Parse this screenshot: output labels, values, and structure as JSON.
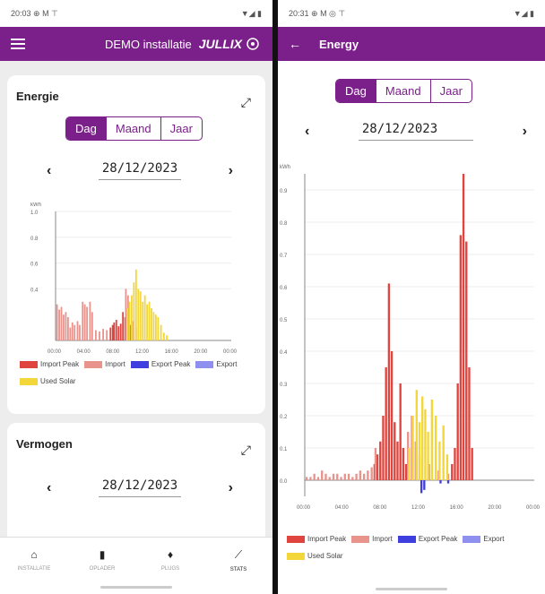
{
  "left": {
    "status": {
      "time": "20:03 ⊕ M ⊤",
      "icons": "▼◢ ▮"
    },
    "appbar": {
      "title": "DEMO installatie",
      "brand": "JULLIX"
    },
    "energy_card": {
      "title": "Energie",
      "tabs": [
        "Dag",
        "Maand",
        "Jaar"
      ],
      "date": "28/12/2023",
      "prev": "‹",
      "next": "›",
      "unit": "kWh"
    },
    "power_card": {
      "title": "Vermogen",
      "date": "28/12/2023",
      "prev": "‹",
      "next": "›"
    },
    "nav": [
      {
        "label": "INSTALLATIE",
        "icon": "home-bolt-icon"
      },
      {
        "label": "OPLADER",
        "icon": "charger-icon"
      },
      {
        "label": "PLUGS",
        "icon": "plug-icon"
      },
      {
        "label": "STATS",
        "icon": "chart-icon"
      }
    ]
  },
  "right": {
    "status": {
      "time": "20:31 ⊕ M ◎ ⊤",
      "icons": "▼◢ ▮"
    },
    "appbar": {
      "back": "←",
      "title": "Energy"
    },
    "tabs": [
      "Dag",
      "Maand",
      "Jaar"
    ],
    "date": "28/12/2023",
    "prev": "‹",
    "next": "›",
    "unit": "kWh"
  },
  "legend": [
    {
      "label": "Import Peak",
      "color": "#e0443e"
    },
    {
      "label": "Import",
      "color": "#e8938c"
    },
    {
      "label": "Export Peak",
      "color": "#3f3fe0"
    },
    {
      "label": "Export",
      "color": "#8f8ff0"
    },
    {
      "label": "Used Solar",
      "color": "#f2d63a"
    }
  ],
  "chart_data": [
    {
      "type": "bar",
      "title": "",
      "ylabel": "kWh",
      "x_ticks": [
        "00:00",
        "04:00",
        "08:00",
        "12:00",
        "16:00",
        "20:00",
        "00:00"
      ],
      "y_ticks": [
        "1.0",
        "0.8",
        "0.6",
        "0.4"
      ],
      "ylim": [
        0,
        1.0
      ],
      "series": [
        {
          "name": "Import Peak",
          "color": "#e0443e",
          "points": [
            [
              7.5,
              0.1
            ],
            [
              7.8,
              0.12
            ],
            [
              8.0,
              0.14
            ],
            [
              8.3,
              0.16
            ],
            [
              8.6,
              0.11
            ],
            [
              8.9,
              0.13
            ],
            [
              9.2,
              0.22
            ],
            [
              9.5,
              0.18
            ],
            [
              10.2,
              0.12
            ]
          ]
        },
        {
          "name": "Import",
          "color": "#e8938c",
          "points": [
            [
              0.2,
              0.28
            ],
            [
              0.5,
              0.24
            ],
            [
              0.8,
              0.26
            ],
            [
              1.1,
              0.2
            ],
            [
              1.4,
              0.22
            ],
            [
              1.7,
              0.18
            ],
            [
              2.0,
              0.1
            ],
            [
              2.3,
              0.14
            ],
            [
              2.6,
              0.12
            ],
            [
              3.0,
              0.15
            ],
            [
              3.3,
              0.12
            ],
            [
              3.7,
              0.3
            ],
            [
              4.0,
              0.28
            ],
            [
              4.3,
              0.26
            ],
            [
              4.7,
              0.3
            ],
            [
              5.0,
              0.22
            ],
            [
              5.5,
              0.08
            ],
            [
              6.0,
              0.07
            ],
            [
              6.5,
              0.09
            ],
            [
              7.0,
              0.08
            ],
            [
              9.6,
              0.4
            ],
            [
              9.9,
              0.35
            ],
            [
              10.6,
              0.15
            ],
            [
              11.0,
              0.1
            ]
          ]
        },
        {
          "name": "Used Solar",
          "color": "#f2d63a",
          "points": [
            [
              9.8,
              0.25
            ],
            [
              10.1,
              0.3
            ],
            [
              10.4,
              0.35
            ],
            [
              10.7,
              0.45
            ],
            [
              11.0,
              0.55
            ],
            [
              11.3,
              0.4
            ],
            [
              11.6,
              0.38
            ],
            [
              11.9,
              0.3
            ],
            [
              12.2,
              0.35
            ],
            [
              12.5,
              0.28
            ],
            [
              12.8,
              0.3
            ],
            [
              13.1,
              0.25
            ],
            [
              13.4,
              0.22
            ],
            [
              13.7,
              0.2
            ],
            [
              14.0,
              0.18
            ],
            [
              14.4,
              0.12
            ],
            [
              14.8,
              0.06
            ],
            [
              15.2,
              0.04
            ]
          ]
        }
      ]
    },
    {
      "type": "bar",
      "title": "",
      "ylabel": "kWh",
      "x_ticks": [
        "00:00",
        "04:00",
        "08:00",
        "12:00",
        "16:00",
        "20:00",
        "00:00"
      ],
      "y_ticks": [
        "0.9",
        "0.8",
        "0.7",
        "0.6",
        "0.5",
        "0.4",
        "0.3",
        "0.2",
        "0.1",
        "0.0"
      ],
      "ylim": [
        -0.05,
        0.95
      ],
      "series": [
        {
          "name": "Import Peak",
          "color": "#e0443e",
          "points": [
            [
              7.3,
              0.05
            ],
            [
              7.6,
              0.08
            ],
            [
              7.9,
              0.12
            ],
            [
              8.2,
              0.2
            ],
            [
              8.5,
              0.35
            ],
            [
              8.8,
              0.61
            ],
            [
              9.1,
              0.4
            ],
            [
              9.4,
              0.18
            ],
            [
              9.7,
              0.12
            ],
            [
              10.0,
              0.3
            ],
            [
              10.3,
              0.1
            ],
            [
              10.6,
              0.05
            ],
            [
              15.4,
              0.05
            ],
            [
              15.7,
              0.1
            ],
            [
              16.0,
              0.3
            ],
            [
              16.3,
              0.76
            ],
            [
              16.6,
              0.95
            ],
            [
              16.9,
              0.74
            ],
            [
              17.2,
              0.35
            ],
            [
              17.5,
              0.1
            ]
          ]
        },
        {
          "name": "Import",
          "color": "#e8938c",
          "points": [
            [
              0.2,
              0.01
            ],
            [
              0.6,
              0.01
            ],
            [
              1.0,
              0.02
            ],
            [
              1.4,
              0.01
            ],
            [
              1.8,
              0.03
            ],
            [
              2.2,
              0.02
            ],
            [
              2.6,
              0.01
            ],
            [
              3.0,
              0.02
            ],
            [
              3.4,
              0.02
            ],
            [
              3.8,
              0.01
            ],
            [
              4.2,
              0.02
            ],
            [
              4.6,
              0.02
            ],
            [
              5.0,
              0.01
            ],
            [
              5.4,
              0.02
            ],
            [
              5.8,
              0.03
            ],
            [
              6.2,
              0.02
            ],
            [
              6.6,
              0.03
            ],
            [
              7.0,
              0.04
            ],
            [
              7.4,
              0.1
            ],
            [
              10.8,
              0.15
            ],
            [
              11.2,
              0.2
            ],
            [
              11.6,
              0.12
            ],
            [
              12.0,
              0.08
            ],
            [
              13.0,
              0.05
            ],
            [
              14.0,
              0.03
            ],
            [
              15.0,
              0.02
            ]
          ]
        },
        {
          "name": "Export Peak",
          "color": "#3f3fe0",
          "points": [
            [
              12.2,
              -0.04
            ],
            [
              12.5,
              -0.03
            ],
            [
              14.2,
              -0.01
            ],
            [
              15.0,
              -0.01
            ]
          ]
        },
        {
          "name": "Used Solar",
          "color": "#f2d63a",
          "points": [
            [
              10.9,
              0.1
            ],
            [
              11.3,
              0.2
            ],
            [
              11.7,
              0.28
            ],
            [
              12.0,
              0.18
            ],
            [
              12.3,
              0.26
            ],
            [
              12.6,
              0.22
            ],
            [
              12.9,
              0.15
            ],
            [
              13.3,
              0.25
            ],
            [
              13.7,
              0.2
            ],
            [
              14.1,
              0.12
            ],
            [
              14.5,
              0.17
            ],
            [
              14.9,
              0.08
            ]
          ]
        }
      ]
    }
  ]
}
